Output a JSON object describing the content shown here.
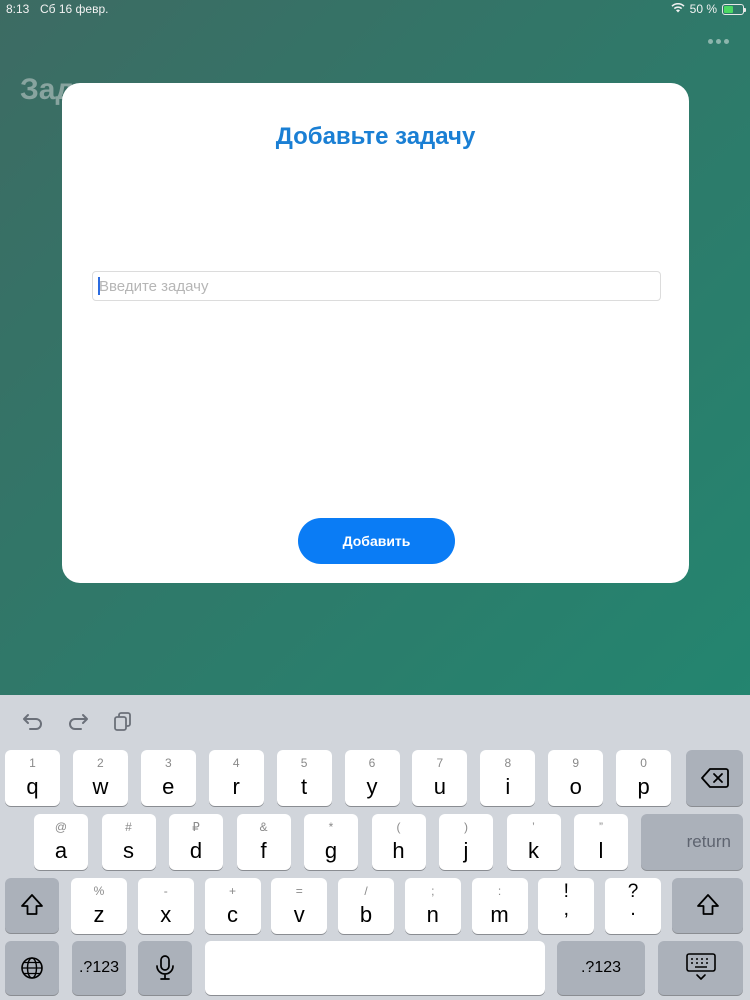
{
  "status_bar": {
    "time": "8:13",
    "date": "Сб 16 февр.",
    "battery": "50 %",
    "battery_level": 0.5
  },
  "background": {
    "title": "Задачи"
  },
  "modal": {
    "title": "Добавьте задачу",
    "input_placeholder": "Введите задачу",
    "input_value": "",
    "add_button": "Добавить"
  },
  "keyboard": {
    "row1": [
      {
        "hint": "1",
        "key": "q"
      },
      {
        "hint": "2",
        "key": "w"
      },
      {
        "hint": "3",
        "key": "e"
      },
      {
        "hint": "4",
        "key": "r"
      },
      {
        "hint": "5",
        "key": "t"
      },
      {
        "hint": "6",
        "key": "y"
      },
      {
        "hint": "7",
        "key": "u"
      },
      {
        "hint": "8",
        "key": "i"
      },
      {
        "hint": "9",
        "key": "o"
      },
      {
        "hint": "0",
        "key": "p"
      }
    ],
    "row2": [
      {
        "hint": "@",
        "key": "a"
      },
      {
        "hint": "#",
        "key": "s"
      },
      {
        "hint": "₽",
        "key": "d"
      },
      {
        "hint": "&",
        "key": "f"
      },
      {
        "hint": "*",
        "key": "g"
      },
      {
        "hint": "(",
        "key": "h"
      },
      {
        "hint": ")",
        "key": "j"
      },
      {
        "hint": "’",
        "key": "k"
      },
      {
        "hint": "”",
        "key": "l"
      }
    ],
    "row3": [
      {
        "hint": "%",
        "key": "z"
      },
      {
        "hint": "-",
        "key": "x"
      },
      {
        "hint": "+",
        "key": "c"
      },
      {
        "hint": "=",
        "key": "v"
      },
      {
        "hint": "/",
        "key": "b"
      },
      {
        "hint": ";",
        "key": "n"
      },
      {
        "hint": ":",
        "key": "m"
      },
      {
        "hint": "!",
        "key": ","
      },
      {
        "hint": "?",
        "key": "."
      }
    ],
    "return_label": "return",
    "numbers_label": ".?123",
    "icons": [
      "undo-icon",
      "redo-icon",
      "paste-icon",
      "backspace-icon",
      "shift-icon",
      "globe-icon",
      "microphone-icon",
      "keyboard-dismiss-icon",
      "more-icon",
      "wifi-icon",
      "battery-icon"
    ]
  }
}
